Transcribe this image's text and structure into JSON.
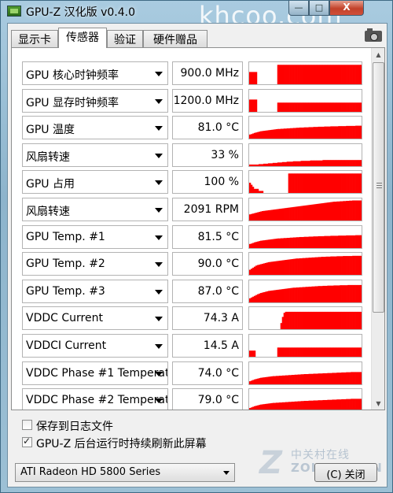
{
  "window": {
    "title": "GPU-Z 汉化版 v0.4.0",
    "watermark": "khcoo.com",
    "min_label": "—",
    "max_label": "□",
    "close_label": "X"
  },
  "tabs": [
    {
      "label": "显示卡"
    },
    {
      "label": "传感器"
    },
    {
      "label": "验证"
    },
    {
      "label": "硬件赠品"
    }
  ],
  "sensors": [
    {
      "name": "GPU 核心时钟频率",
      "value": "900.0 MHz",
      "graph": [
        0.6,
        0.6,
        0.6,
        0.6,
        0.6,
        0,
        0,
        0,
        0,
        0,
        0,
        0,
        0,
        0,
        0,
        0,
        0,
        0,
        0.95,
        0.95,
        0.95,
        0.95,
        0.95,
        0.95,
        0.95,
        0.95,
        0.95,
        0.95,
        0.95,
        0.95,
        0.95,
        0.95,
        0.95,
        0.95,
        0.95,
        0.95,
        0.95,
        0.95,
        0.95,
        0.95,
        0.95,
        0.95,
        0.95,
        0.95,
        0.95,
        0.95,
        0.95,
        0.95,
        0.95,
        0.95,
        0.95,
        0.95,
        0.95,
        0.95,
        0.95,
        0.95,
        0.95,
        0.95,
        0.95,
        0.95,
        0.95,
        0.95,
        0.95,
        0.95,
        0.95,
        0.95,
        0.95,
        0.95,
        0.95,
        0.95,
        0.95,
        0.95
      ]
    },
    {
      "name": "GPU 显存时钟频率",
      "value": "1200.0 MHz",
      "graph": [
        0.6,
        0.6,
        0.6,
        0.6,
        0.6,
        0,
        0,
        0,
        0,
        0,
        0,
        0,
        0,
        0,
        0,
        0,
        0,
        0,
        0.45,
        0.45,
        0.45,
        0.45,
        0.45,
        0.45,
        0.45,
        0.45,
        0.45,
        0.45,
        0.45,
        0.45,
        0.45,
        0.45,
        0.45,
        0.45,
        0.45,
        0.45,
        0.45,
        0.45,
        0.45,
        0.45,
        0.45,
        0.45,
        0.45,
        0.45,
        0.45,
        0.45,
        0.45,
        0.45,
        0.45,
        0.45,
        0.45,
        0.45,
        0.45,
        0.45,
        0.45,
        0.45,
        0.45,
        0.45,
        0.45,
        0.45,
        0.45,
        0.45,
        0.45,
        0.45,
        0.45,
        0.45,
        0.45,
        0.45,
        0.45,
        0.45,
        0.45,
        0.45
      ]
    },
    {
      "name": "GPU 温度",
      "value": "81.0 °C",
      "graph": [
        0.2,
        0.22,
        0.25,
        0.28,
        0.3,
        0.32,
        0.34,
        0.36,
        0.37,
        0.38,
        0.39,
        0.4,
        0.41,
        0.42,
        0.43,
        0.44,
        0.45,
        0.46,
        0.47,
        0.47,
        0.48,
        0.48,
        0.49,
        0.49,
        0.5,
        0.5,
        0.51,
        0.51,
        0.52,
        0.52,
        0.53,
        0.53,
        0.54,
        0.54,
        0.54,
        0.55,
        0.55,
        0.55,
        0.56,
        0.56,
        0.56,
        0.57,
        0.57,
        0.57,
        0.58,
        0.58,
        0.58,
        0.58,
        0.59,
        0.59,
        0.59,
        0.59,
        0.6,
        0.6,
        0.6,
        0.6,
        0.6,
        0.61,
        0.61,
        0.61,
        0.61,
        0.61,
        0.62,
        0.62,
        0.62,
        0.62,
        0.62,
        0.62,
        0.63,
        0.63,
        0.63,
        0.63
      ]
    },
    {
      "name": "风扇转速",
      "value": "33 %",
      "graph": [
        0.08,
        0.08,
        0.08,
        0.08,
        0.08,
        0.08,
        0.1,
        0.1,
        0.1,
        0.12,
        0.12,
        0.12,
        0.14,
        0.14,
        0.14,
        0.16,
        0.16,
        0.16,
        0.18,
        0.18,
        0.18,
        0.2,
        0.2,
        0.2,
        0.22,
        0.22,
        0.22,
        0.22,
        0.24,
        0.24,
        0.24,
        0.24,
        0.24,
        0.26,
        0.26,
        0.26,
        0.26,
        0.26,
        0.26,
        0.28,
        0.28,
        0.28,
        0.28,
        0.28,
        0.28,
        0.28,
        0.28,
        0.3,
        0.3,
        0.3,
        0.3,
        0.3,
        0.3,
        0.3,
        0.3,
        0.3,
        0.3,
        0.3,
        0.3,
        0.3,
        0.3,
        0.3,
        0.3,
        0.3,
        0.3,
        0.3,
        0.3,
        0.3,
        0.3,
        0.3,
        0.3,
        0.3
      ]
    },
    {
      "name": "GPU 占用",
      "value": "100 %",
      "graph": [
        0.5,
        0.4,
        0.3,
        0.2,
        0.2,
        0.2,
        0.1,
        0.1,
        0.1,
        0,
        0,
        0,
        0,
        0,
        0,
        0,
        0,
        0,
        0,
        0,
        0,
        0,
        0,
        0,
        0,
        0.95,
        0.95,
        0.95,
        0.95,
        0.95,
        0.95,
        0.95,
        0.95,
        0.95,
        0.95,
        0.95,
        0.95,
        0.95,
        0.95,
        0.95,
        0.95,
        0.95,
        0.95,
        0.95,
        0.95,
        0.95,
        0.95,
        0.95,
        0.95,
        0.95,
        0.95,
        0.95,
        0.95,
        0.95,
        0.95,
        0.95,
        0.95,
        0.95,
        0.95,
        0.95,
        0.95,
        0.95,
        0.95,
        0.95,
        0.95,
        0.95,
        0.95,
        0.95,
        0.95,
        0.95,
        0.95,
        0.95
      ]
    },
    {
      "name": "风扇转速",
      "value": "2091 RPM",
      "graph": [
        0.3,
        0.32,
        0.34,
        0.36,
        0.38,
        0.4,
        0.42,
        0.44,
        0.46,
        0.47,
        0.48,
        0.49,
        0.5,
        0.51,
        0.52,
        0.53,
        0.54,
        0.55,
        0.56,
        0.57,
        0.58,
        0.59,
        0.6,
        0.61,
        0.62,
        0.63,
        0.64,
        0.65,
        0.66,
        0.67,
        0.68,
        0.69,
        0.7,
        0.71,
        0.72,
        0.73,
        0.74,
        0.75,
        0.76,
        0.77,
        0.78,
        0.79,
        0.8,
        0.81,
        0.82,
        0.83,
        0.84,
        0.85,
        0.86,
        0.87,
        0.88,
        0.89,
        0.9,
        0.91,
        0.92,
        0.92,
        0.93,
        0.93,
        0.94,
        0.94,
        0.95,
        0.95,
        0.96,
        0.96,
        0.97,
        0.97,
        0.98,
        0.98,
        0.98,
        0.98,
        0.98,
        0.98
      ]
    },
    {
      "name": "GPU Temp. #1",
      "value": "81.5 °C",
      "graph": [
        0.2,
        0.22,
        0.25,
        0.28,
        0.3,
        0.32,
        0.34,
        0.36,
        0.37,
        0.38,
        0.39,
        0.4,
        0.41,
        0.42,
        0.43,
        0.44,
        0.45,
        0.46,
        0.47,
        0.47,
        0.48,
        0.48,
        0.49,
        0.49,
        0.5,
        0.5,
        0.51,
        0.51,
        0.52,
        0.52,
        0.53,
        0.53,
        0.54,
        0.54,
        0.54,
        0.55,
        0.55,
        0.55,
        0.56,
        0.56,
        0.56,
        0.57,
        0.57,
        0.57,
        0.58,
        0.58,
        0.58,
        0.58,
        0.59,
        0.59,
        0.59,
        0.59,
        0.6,
        0.6,
        0.6,
        0.6,
        0.6,
        0.61,
        0.61,
        0.61,
        0.61,
        0.61,
        0.62,
        0.62,
        0.62,
        0.62,
        0.62,
        0.62,
        0.63,
        0.63,
        0.63,
        0.63
      ]
    },
    {
      "name": "GPU Temp. #2",
      "value": "90.0 °C",
      "graph": [
        0.25,
        0.3,
        0.35,
        0.4,
        0.45,
        0.48,
        0.5,
        0.52,
        0.54,
        0.56,
        0.58,
        0.6,
        0.62,
        0.63,
        0.64,
        0.65,
        0.66,
        0.67,
        0.68,
        0.69,
        0.7,
        0.71,
        0.72,
        0.73,
        0.74,
        0.75,
        0.76,
        0.77,
        0.78,
        0.79,
        0.8,
        0.8,
        0.81,
        0.81,
        0.82,
        0.82,
        0.83,
        0.83,
        0.84,
        0.84,
        0.85,
        0.85,
        0.86,
        0.86,
        0.87,
        0.87,
        0.88,
        0.88,
        0.88,
        0.89,
        0.89,
        0.89,
        0.9,
        0.9,
        0.9,
        0.9,
        0.91,
        0.91,
        0.91,
        0.91,
        0.92,
        0.92,
        0.92,
        0.92,
        0.92,
        0.92,
        0.93,
        0.93,
        0.93,
        0.93,
        0.93,
        0.93
      ]
    },
    {
      "name": "GPU Temp. #3",
      "value": "87.0 °C",
      "graph": [
        0.2,
        0.24,
        0.28,
        0.32,
        0.36,
        0.4,
        0.43,
        0.46,
        0.48,
        0.5,
        0.52,
        0.54,
        0.56,
        0.57,
        0.58,
        0.59,
        0.6,
        0.61,
        0.62,
        0.63,
        0.64,
        0.65,
        0.66,
        0.67,
        0.68,
        0.69,
        0.7,
        0.71,
        0.72,
        0.72,
        0.73,
        0.73,
        0.74,
        0.74,
        0.75,
        0.75,
        0.76,
        0.76,
        0.77,
        0.77,
        0.78,
        0.78,
        0.79,
        0.79,
        0.8,
        0.8,
        0.8,
        0.81,
        0.81,
        0.81,
        0.82,
        0.82,
        0.82,
        0.82,
        0.83,
        0.83,
        0.83,
        0.83,
        0.84,
        0.84,
        0.84,
        0.84,
        0.84,
        0.85,
        0.85,
        0.85,
        0.85,
        0.85,
        0.85,
        0.85,
        0.85,
        0.85
      ]
    },
    {
      "name": "VDDC Current",
      "value": "74.3 A",
      "graph": [
        0,
        0,
        0,
        0,
        0,
        0,
        0,
        0,
        0,
        0,
        0,
        0,
        0,
        0,
        0,
        0,
        0,
        0,
        0,
        0,
        0.3,
        0.6,
        0.8,
        0.85,
        0.85,
        0.85,
        0.85,
        0.85,
        0.85,
        0.85,
        0.85,
        0.85,
        0.85,
        0.85,
        0.85,
        0.85,
        0.85,
        0.85,
        0.85,
        0.85,
        0.85,
        0.85,
        0.85,
        0.85,
        0.85,
        0.85,
        0.85,
        0.85,
        0.85,
        0.85,
        0.85,
        0.85,
        0.85,
        0.85,
        0.85,
        0.85,
        0.85,
        0.85,
        0.85,
        0.85,
        0.85,
        0.85,
        0.85,
        0.85,
        0.85,
        0.85,
        0.85,
        0.85,
        0.85,
        0.85,
        0.85,
        0.85
      ]
    },
    {
      "name": "VDDCI Current",
      "value": "14.5 A",
      "graph": [
        0.3,
        0.3,
        0.3,
        0.3,
        0,
        0,
        0,
        0,
        0,
        0,
        0,
        0,
        0,
        0,
        0,
        0,
        0,
        0,
        0.45,
        0.45,
        0.45,
        0.45,
        0.45,
        0.45,
        0.45,
        0.45,
        0.45,
        0.45,
        0.45,
        0.45,
        0.45,
        0.45,
        0.45,
        0.45,
        0.45,
        0.45,
        0.45,
        0.45,
        0.45,
        0.45,
        0.45,
        0.45,
        0.45,
        0.45,
        0.45,
        0.45,
        0.45,
        0.45,
        0.45,
        0.45,
        0.45,
        0.45,
        0.45,
        0.45,
        0.45,
        0.45,
        0.45,
        0.45,
        0.45,
        0.45,
        0.45,
        0.45,
        0.45,
        0.45,
        0.45,
        0.45,
        0.45,
        0.45,
        0.45,
        0.45,
        0.45,
        0.45
      ]
    },
    {
      "name": "VDDC Phase #1 Temperat...",
      "value": "74.0 °C",
      "graph": [
        0.15,
        0.18,
        0.21,
        0.24,
        0.26,
        0.28,
        0.3,
        0.32,
        0.33,
        0.34,
        0.35,
        0.36,
        0.37,
        0.38,
        0.39,
        0.4,
        0.4,
        0.41,
        0.41,
        0.42,
        0.42,
        0.43,
        0.43,
        0.44,
        0.44,
        0.45,
        0.45,
        0.46,
        0.46,
        0.47,
        0.47,
        0.48,
        0.48,
        0.49,
        0.49,
        0.5,
        0.5,
        0.5,
        0.51,
        0.51,
        0.51,
        0.52,
        0.52,
        0.52,
        0.53,
        0.53,
        0.53,
        0.54,
        0.54,
        0.54,
        0.55,
        0.55,
        0.55,
        0.56,
        0.56,
        0.56,
        0.57,
        0.57,
        0.57,
        0.58,
        0.58,
        0.58,
        0.59,
        0.59,
        0.59,
        0.6,
        0.6,
        0.6,
        0.6,
        0.6,
        0.6,
        0.6
      ]
    },
    {
      "name": "VDDC Phase #2 Temperat...",
      "value": "79.0 °C",
      "graph": [
        0.15,
        0.18,
        0.21,
        0.24,
        0.26,
        0.28,
        0.3,
        0.32,
        0.33,
        0.34,
        0.35,
        0.36,
        0.37,
        0.38,
        0.39,
        0.4,
        0.4,
        0.41,
        0.41,
        0.42,
        0.42,
        0.43,
        0.43,
        0.44,
        0.44,
        0.45,
        0.45,
        0.46,
        0.46,
        0.47,
        0.47,
        0.48,
        0.48,
        0.49,
        0.49,
        0.5,
        0.5,
        0.5,
        0.51,
        0.51,
        0.51,
        0.52,
        0.52,
        0.52,
        0.53,
        0.53,
        0.53,
        0.54,
        0.54,
        0.54,
        0.55,
        0.55,
        0.55,
        0.56,
        0.56,
        0.56,
        0.57,
        0.57,
        0.57,
        0.58,
        0.58,
        0.58,
        0.59,
        0.59,
        0.59,
        0.6,
        0.6,
        0.6,
        0.6,
        0.6,
        0.6,
        0.6
      ]
    }
  ],
  "graph_color": "#ff0000",
  "options": {
    "log_to_file": {
      "label": "保存到日志文件",
      "checked": false
    },
    "background_refresh": {
      "label": "GPU-Z 后台运行时持续刷新此屏幕",
      "checked": true
    }
  },
  "gpu_select": {
    "value": "ATI Radeon HD 5800 Series"
  },
  "close_button": {
    "label": "(C) 关闭"
  },
  "zol_watermark": {
    "cn": "中关村在线",
    "en": "ZOL.COM.CN",
    "z": "Z"
  }
}
